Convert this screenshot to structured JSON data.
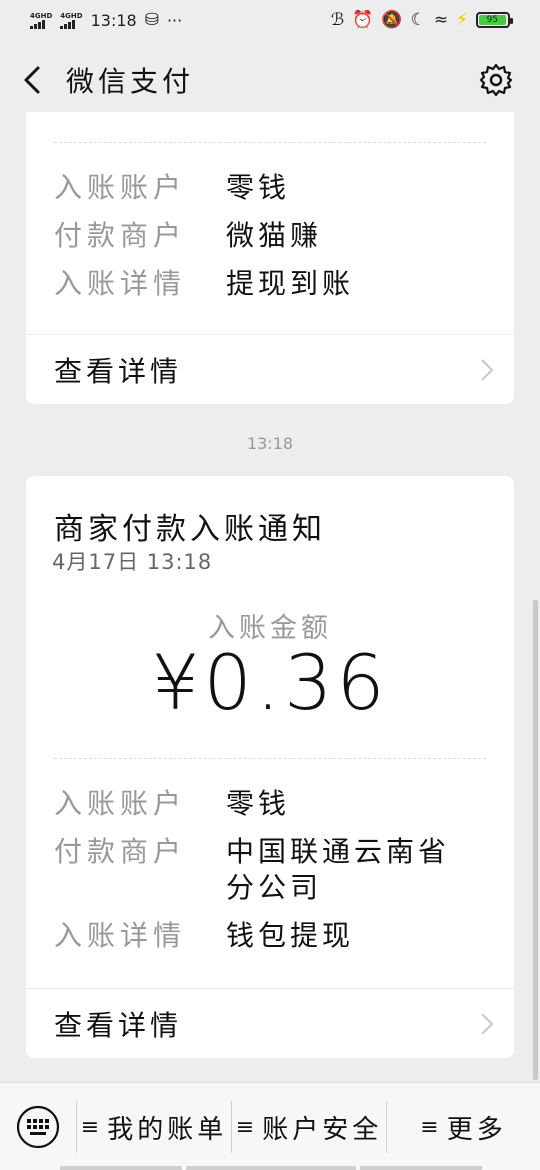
{
  "status_bar": {
    "network1": "4GHD",
    "network2": "4GHD",
    "time": "13:18",
    "more": "···",
    "battery": "95"
  },
  "nav": {
    "title": "微信支付"
  },
  "card1": {
    "rows": [
      {
        "label": "入账账户",
        "value": "零钱"
      },
      {
        "label": "付款商户",
        "value": "微猫赚"
      },
      {
        "label": "入账详情",
        "value": "提现到账"
      }
    ],
    "detail_label": "查看详情"
  },
  "time_separator": "13:18",
  "card2": {
    "title": "商家付款入账通知",
    "date": "4月17日 13:18",
    "amount_label": "入账金额",
    "amount": "¥0.36",
    "rows": [
      {
        "label": "入账账户",
        "value": "零钱"
      },
      {
        "label": "付款商户",
        "value": "中国联通云南省",
        "value2": "分公司"
      },
      {
        "label": "入账详情",
        "value": "钱包提现"
      }
    ],
    "detail_label": "查看详情"
  },
  "bottom_menu": {
    "items": [
      {
        "label": "我的账单"
      },
      {
        "label": "账户安全"
      },
      {
        "label": "更多"
      }
    ]
  },
  "icons": {
    "back": "back-arrow-icon",
    "settings": "gear-icon",
    "keyboard": "keyboard-icon",
    "chevron": "chevron-right-icon"
  },
  "colors": {
    "background": "#ededed",
    "card": "#ffffff",
    "label": "#999999",
    "battery": "#4cc74a"
  }
}
